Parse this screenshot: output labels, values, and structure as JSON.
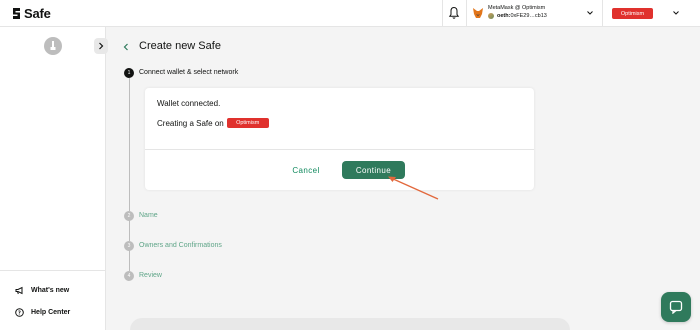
{
  "header": {
    "logo_text": "Safe",
    "wallet": {
      "name": "MetaMask @ Optimism",
      "prefix": "oeth:",
      "address": "0xFE29…cb13"
    },
    "network": "Optimism"
  },
  "sidebar": {
    "whats_new": "What's new",
    "help_center": "Help Center"
  },
  "page": {
    "title": "Create new Safe"
  },
  "steps": [
    {
      "number": "1",
      "label": "Connect wallet & select network"
    },
    {
      "number": "2",
      "label": "Name"
    },
    {
      "number": "3",
      "label": "Owners and Confirmations"
    },
    {
      "number": "4",
      "label": "Review"
    }
  ],
  "card": {
    "connected_text": "Wallet connected.",
    "creating_text": "Creating a Safe on",
    "chain": "Optimism",
    "cancel_label": "Cancel",
    "continue_label": "Continue"
  },
  "colors": {
    "accent_green": "#2f7a5c",
    "network_red": "#e0312d",
    "annotation_arrow": "#e2683c"
  }
}
